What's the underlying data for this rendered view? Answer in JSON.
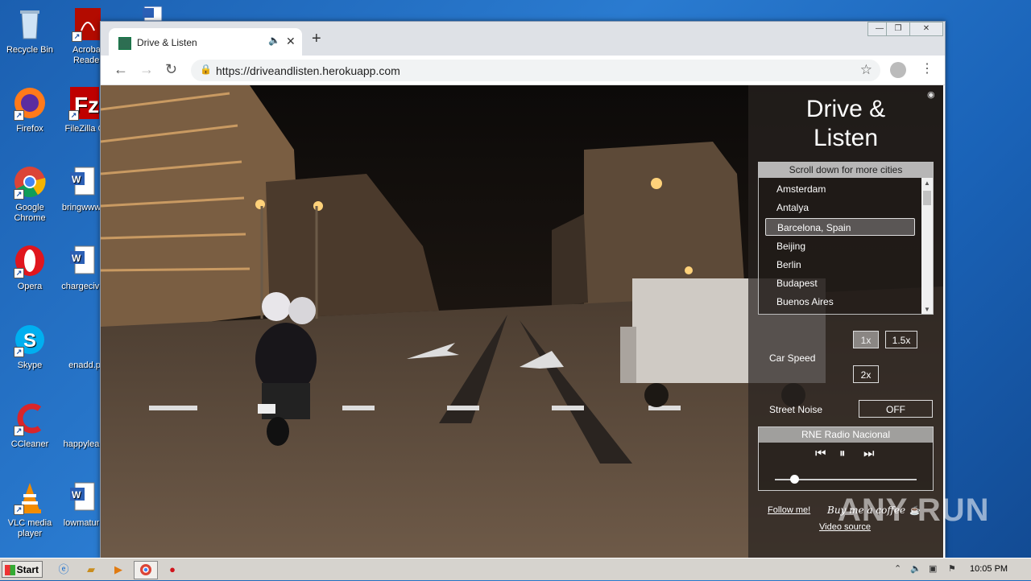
{
  "desktop": {
    "icons": [
      {
        "label": "Recycle Bin",
        "icon": "recycle-bin-icon"
      },
      {
        "label": "Acrobat Reader",
        "icon": "acrobat-icon"
      },
      {
        "label": "",
        "icon": "document-icon"
      },
      {
        "label": "Firefox",
        "icon": "firefox-icon"
      },
      {
        "label": "FileZilla C",
        "icon": "filezilla-icon"
      },
      {
        "label": "Google Chrome",
        "icon": "chrome-icon"
      },
      {
        "label": "bringwww",
        "icon": "word-doc-icon"
      },
      {
        "label": "Opera",
        "icon": "opera-icon"
      },
      {
        "label": "chargecivi",
        "icon": "word-doc-icon"
      },
      {
        "label": "Skype",
        "icon": "skype-icon"
      },
      {
        "label": "enadd.p",
        "icon": "file-icon"
      },
      {
        "label": "CCleaner",
        "icon": "ccleaner-icon"
      },
      {
        "label": "happylea",
        "icon": "file-icon"
      },
      {
        "label": "VLC media player",
        "icon": "vlc-icon"
      },
      {
        "label": "lowmatur",
        "icon": "word-doc-icon"
      }
    ]
  },
  "browser": {
    "tab_title": "Drive & Listen",
    "url": "https://driveandlisten.herokuapp.com",
    "new_tab_symbol": "+"
  },
  "panel": {
    "brand_line1": "Drive &",
    "brand_line2": "Listen",
    "cities_header": "Scroll down for more cities",
    "cities": [
      "Amsterdam",
      "Antalya",
      "Barcelona, Spain",
      "Beijing",
      "Berlin",
      "Budapest",
      "Buenos Aires"
    ],
    "selected_city": "Barcelona, Spain",
    "car_speed_label": "Car Speed",
    "speed_options": [
      "1x",
      "1.5x",
      "2x"
    ],
    "selected_speed": "1x",
    "street_noise_label": "Street Noise",
    "street_noise_value": "OFF",
    "radio_station": "RNE Radio Nacional",
    "volume_fraction": 0.14,
    "follow_link": "Follow me!",
    "coffee_text": "Buy me a coffee",
    "video_source_link": "Video source"
  },
  "watermark": "ANY RUN",
  "taskbar": {
    "start_label": "Start",
    "clock": "10:05 PM"
  }
}
